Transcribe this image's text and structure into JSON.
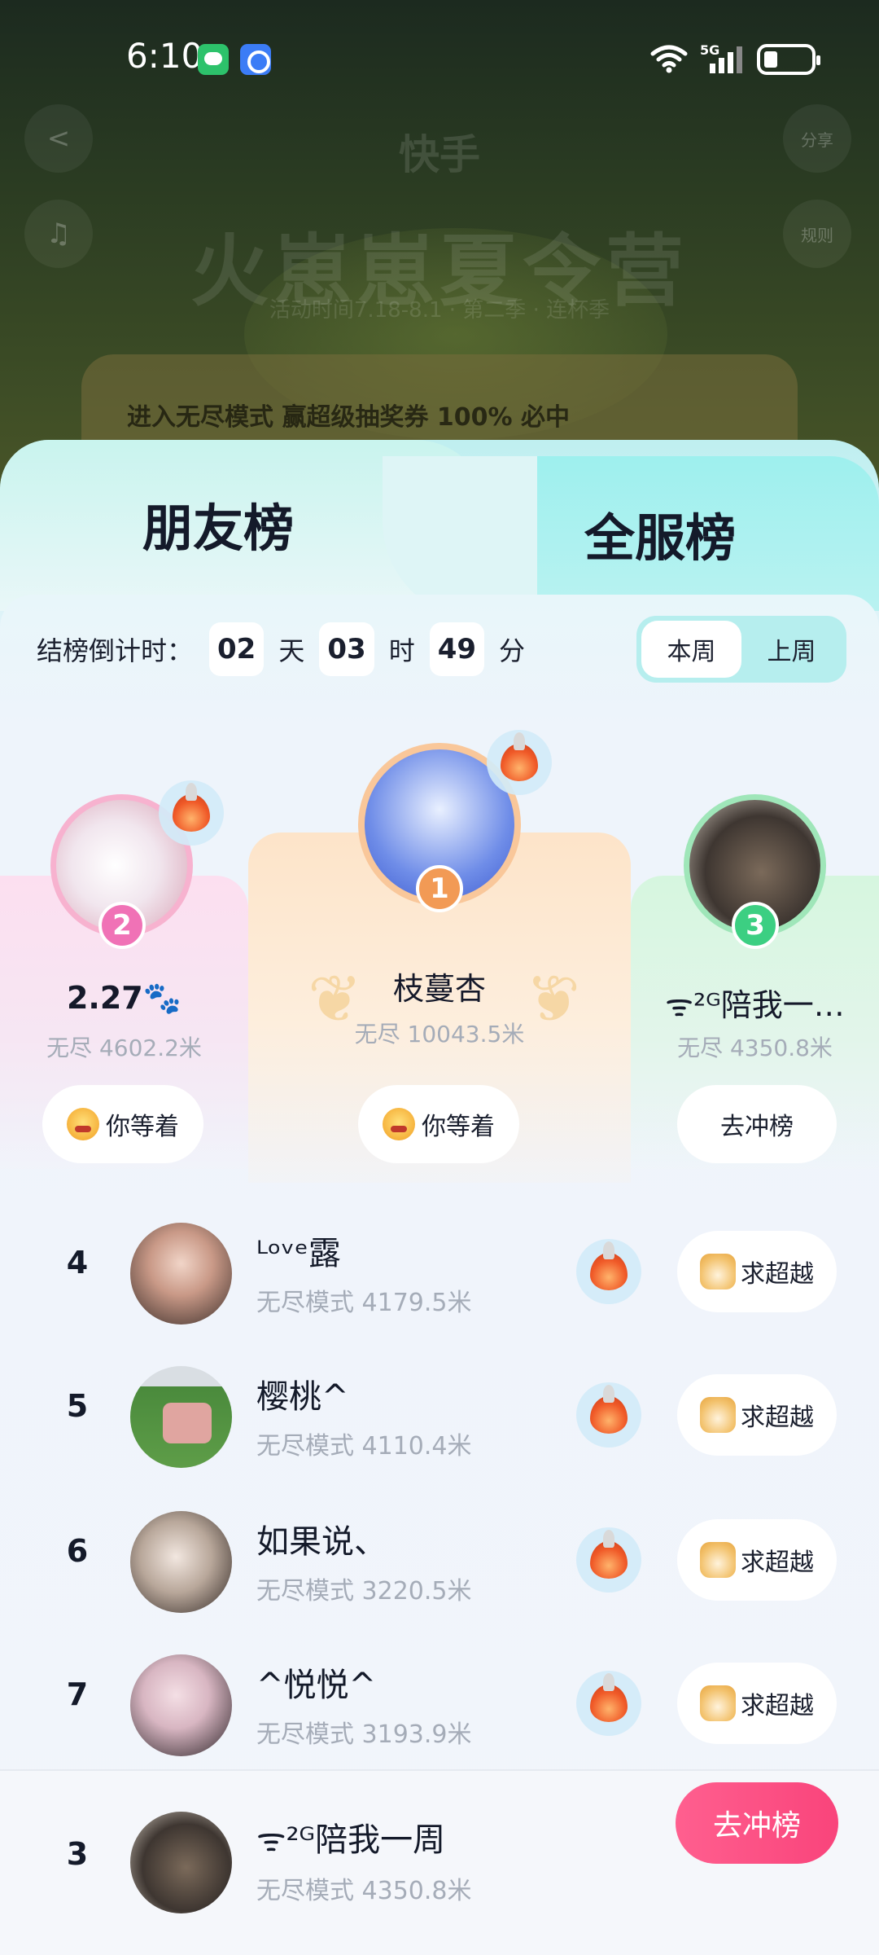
{
  "status_bar": {
    "time": "6:10",
    "network": "5G"
  },
  "background": {
    "brand": "快手",
    "title": "火崽崽夏令营",
    "subtitle": "活动时间7.18-8.1 · 第二季 · 连杯季",
    "left_buttons": [
      "<",
      "♫"
    ],
    "right_buttons": [
      "分享",
      "规则"
    ],
    "banner_prefix": "进入无尽模式 ",
    "banner_bold": "赢超级抽奖券 100% 必中"
  },
  "tabs": {
    "friends": "朋友榜",
    "all": "全服榜"
  },
  "countdown": {
    "label": "结榜倒计时：",
    "days": "02",
    "days_unit": "天",
    "hours": "03",
    "hours_unit": "时",
    "minutes": "49",
    "minutes_unit": "分"
  },
  "week_toggle": {
    "this_week": "本周",
    "last_week": "上周",
    "selected": "this_week"
  },
  "podium": {
    "first": {
      "rank": "1",
      "name": "枝蔓杏",
      "distance": "无尽 10043.5米",
      "action": "你等着"
    },
    "second": {
      "rank": "2",
      "name": "2.27🐾",
      "distance": "无尽 4602.2米",
      "action": "你等着"
    },
    "third": {
      "rank": "3",
      "name": "ᯤ²ᴳ陪我一…",
      "distance": "无尽 4350.8米",
      "action": "去冲榜"
    }
  },
  "list": [
    {
      "rank": "4",
      "name": "ᴸᵒᵛᵉ露",
      "distance": "无尽模式 4179.5米",
      "action": "求超越"
    },
    {
      "rank": "5",
      "name": "樱桃^",
      "distance": "无尽模式 4110.4米",
      "action": "求超越"
    },
    {
      "rank": "6",
      "name": "如果说、",
      "distance": "无尽模式 3220.5米",
      "action": "求超越"
    },
    {
      "rank": "7",
      "name": "^悦悦^",
      "distance": "无尽模式 3193.9米",
      "action": "求超越"
    }
  ],
  "me": {
    "rank": "3",
    "name": "ᯤ²ᴳ陪我一周",
    "distance": "无尽模式 4350.8米",
    "action": "去冲榜"
  },
  "colors": {
    "cta_pink": "#f9447b",
    "tab_cyan": "#9ef0ee",
    "gold": "#f29a55",
    "pink": "#f072b6",
    "green": "#3ccf82"
  }
}
